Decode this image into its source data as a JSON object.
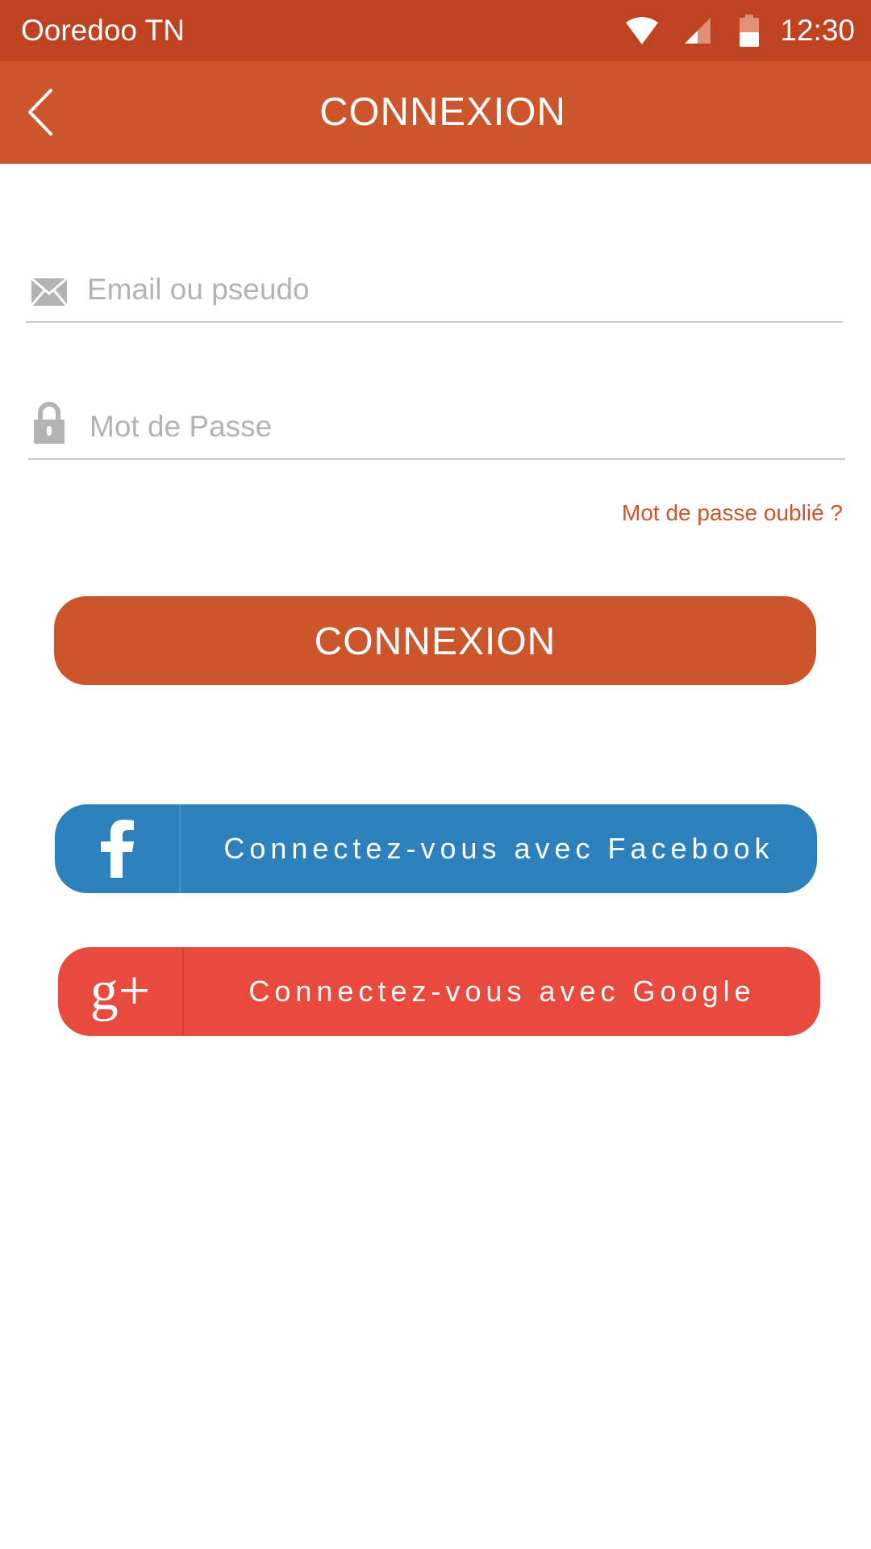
{
  "status_bar": {
    "carrier": "Ooredoo TN",
    "time": "12:30",
    "icons": [
      "wifi-icon",
      "cell-signal-icon",
      "battery-icon"
    ]
  },
  "app_bar": {
    "back_icon": "chevron-left-icon",
    "title": "CONNEXION"
  },
  "form": {
    "email": {
      "icon": "envelope-icon",
      "placeholder": "Email ou pseudo",
      "value": ""
    },
    "password": {
      "icon": "lock-icon",
      "placeholder": "Mot de Passe",
      "value": ""
    },
    "forgot_label": "Mot de passe oublié ?",
    "submit_label": "CONNEXION"
  },
  "social": {
    "facebook": {
      "icon": "facebook-icon",
      "label": "Connectez-vous avec Facebook",
      "color": "#2c80bc"
    },
    "google": {
      "icon": "google-plus-icon",
      "icon_text": "g+",
      "label": "Connectez-vous avec Google",
      "color": "#e84b3d"
    }
  },
  "colors": {
    "status_bar": "#bf4320",
    "primary": "#cd552b"
  }
}
